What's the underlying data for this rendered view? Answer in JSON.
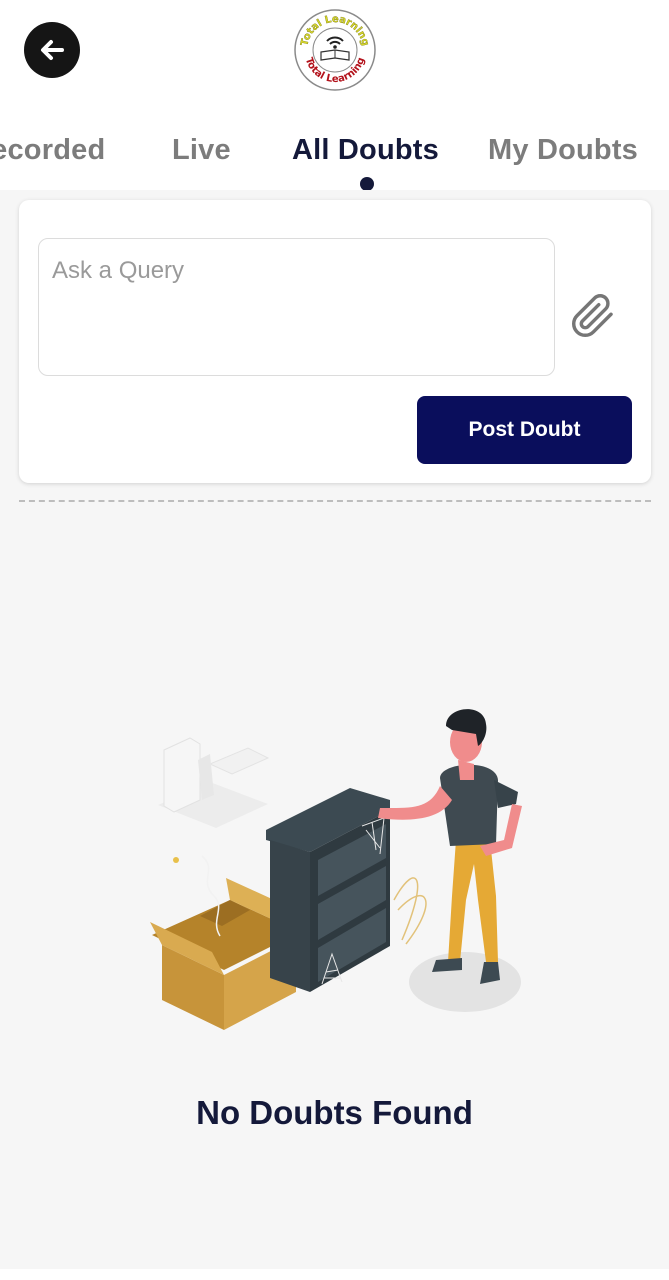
{
  "header": {
    "back_icon": "arrow-left-icon",
    "logo": {
      "top_text": "Total Learning",
      "bottom_text": "Total Learning",
      "icon": "wifi-book-icon"
    }
  },
  "tabs": [
    {
      "label": "Recorded",
      "active": false
    },
    {
      "label": "Live",
      "active": false
    },
    {
      "label": "All Doubts",
      "active": true
    },
    {
      "label": "My Doubts",
      "active": false
    }
  ],
  "query_form": {
    "input_value": "",
    "input_placeholder": "Ask a Query",
    "attach_icon": "paperclip-icon",
    "post_button_label": "Post Doubt"
  },
  "empty_state": {
    "illustration": "empty-shelf-illustration",
    "title": "No Doubts Found"
  },
  "colors": {
    "primary_dark": "#14193a",
    "button_bg": "#0a0e5c",
    "inactive_tab": "#7c7c7c",
    "page_bg": "#f6f6f6"
  }
}
